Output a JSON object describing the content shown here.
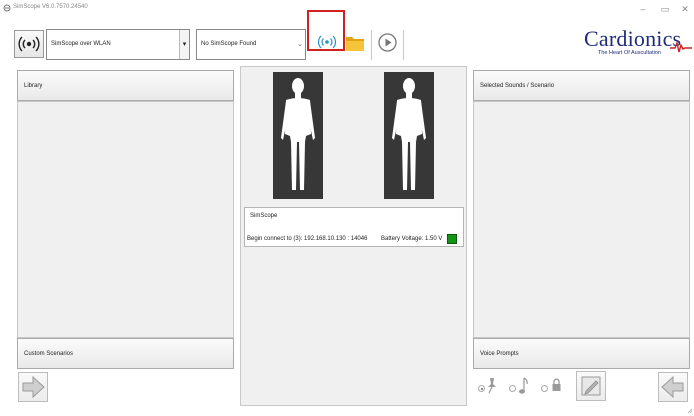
{
  "window": {
    "title": "SimScope V6.0.7570.24540",
    "minimize_glyph": "–",
    "maximize_glyph": "▭",
    "close_glyph": "✕"
  },
  "toolbar": {
    "connection_select": {
      "value": "SimScope over WLAN",
      "arrow": "▾"
    },
    "device_select": {
      "value": "No SimScope Found",
      "arrow": "⌄"
    },
    "icons": [
      "wlan-icon",
      "wifi-signal-icon",
      "folder-icon",
      "play-icon"
    ]
  },
  "logo": {
    "brand": "Cardionics",
    "tagline": "The Heart Of Auscultation"
  },
  "panels": {
    "library": "Library",
    "custom_scenarios": "Custom Scenarios",
    "selected_sounds": "Selected Sounds / Scenario",
    "voice_prompts": "Voice Prompts"
  },
  "status": {
    "title": "SimScope",
    "message": "Begin connect to (3): 192.168.10.130 : 14046",
    "battery_label": "Battery Voltage: 1.50 V",
    "battery_color": "#149414"
  },
  "bottom": {
    "icons": [
      "arrow-right-icon",
      "pushpin-icon",
      "music-note-icon",
      "lock-icon",
      "edit-icon",
      "arrow-left-icon"
    ],
    "radio_selected_index": 0
  },
  "colors": {
    "highlight": "#d0201f",
    "brand": "#1f2c7a",
    "wifi": "#2a8fc7",
    "folder": "#f2b824"
  }
}
